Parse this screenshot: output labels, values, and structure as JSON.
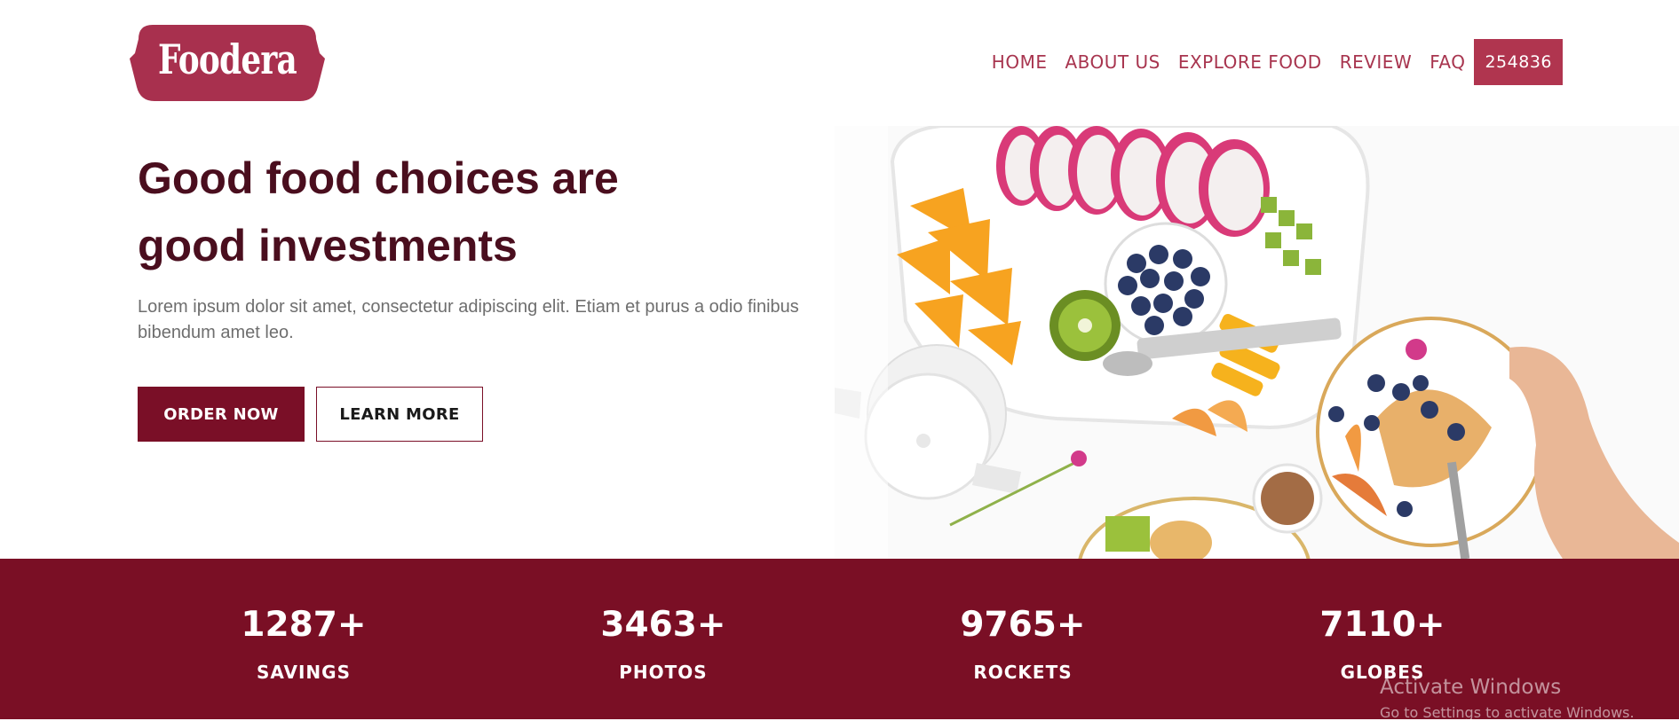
{
  "brand": {
    "name": "Foodera",
    "color": "#a8304e"
  },
  "nav": {
    "items": [
      "HOME",
      "ABOUT US",
      "EXPLORE FOOD",
      "REVIEW",
      "FAQ"
    ],
    "badge": "254836"
  },
  "hero": {
    "title": "Good food choices are good investments",
    "description": "Lorem ipsum dolor sit amet, consectetur adipiscing elit. Etiam et purus a odio finibus bibendum amet leo.",
    "primary_button": "ORDER NOW",
    "secondary_button": "LEARN MORE"
  },
  "stats": [
    {
      "value": "1287+",
      "label": "SAVINGS"
    },
    {
      "value": "3463+",
      "label": "PHOTOS"
    },
    {
      "value": "9765+",
      "label": "ROCKETS"
    },
    {
      "value": "7110+",
      "label": "GLOBES"
    }
  ],
  "watermark": {
    "line1": "Activate Windows",
    "line2": "Go to Settings to activate Windows."
  },
  "colors": {
    "accent": "#7a0f27",
    "nav_text": "#a8354f",
    "heading": "#4a0e1e",
    "stats_bg": "#7a0f25"
  }
}
